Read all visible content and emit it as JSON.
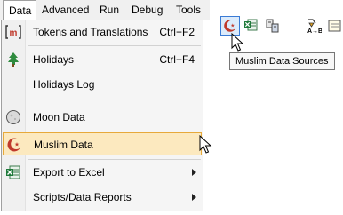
{
  "menubar": {
    "items": [
      {
        "label": "Data"
      },
      {
        "label": "Advanced"
      },
      {
        "label": "Run"
      },
      {
        "label": "Debug"
      },
      {
        "label": "Tools"
      }
    ]
  },
  "data_menu": {
    "items": [
      {
        "label": "Tokens and Translations",
        "shortcut": "Ctrl+F2",
        "icon": "brackets-m-icon"
      },
      {
        "label": "Holidays",
        "shortcut": "Ctrl+F4",
        "icon": "tree-icon"
      },
      {
        "label": "Holidays Log",
        "shortcut": "",
        "icon": ""
      },
      {
        "label": "Moon Data",
        "shortcut": "",
        "icon": "moon-icon"
      },
      {
        "label": "Muslim Data",
        "shortcut": "",
        "icon": "crescent-star-icon"
      },
      {
        "label": "Export to Excel",
        "shortcut": "",
        "icon": "excel-icon",
        "submenu": true
      },
      {
        "label": "Scripts/Data Reports",
        "shortcut": "",
        "icon": "",
        "submenu": true
      }
    ]
  },
  "toolbar": {
    "tooltip": "Muslim Data Sources"
  },
  "colors": {
    "highlight_bg": "#fce9bf",
    "highlight_border": "#e7a93a",
    "pressed_button": "#dcebfb"
  }
}
